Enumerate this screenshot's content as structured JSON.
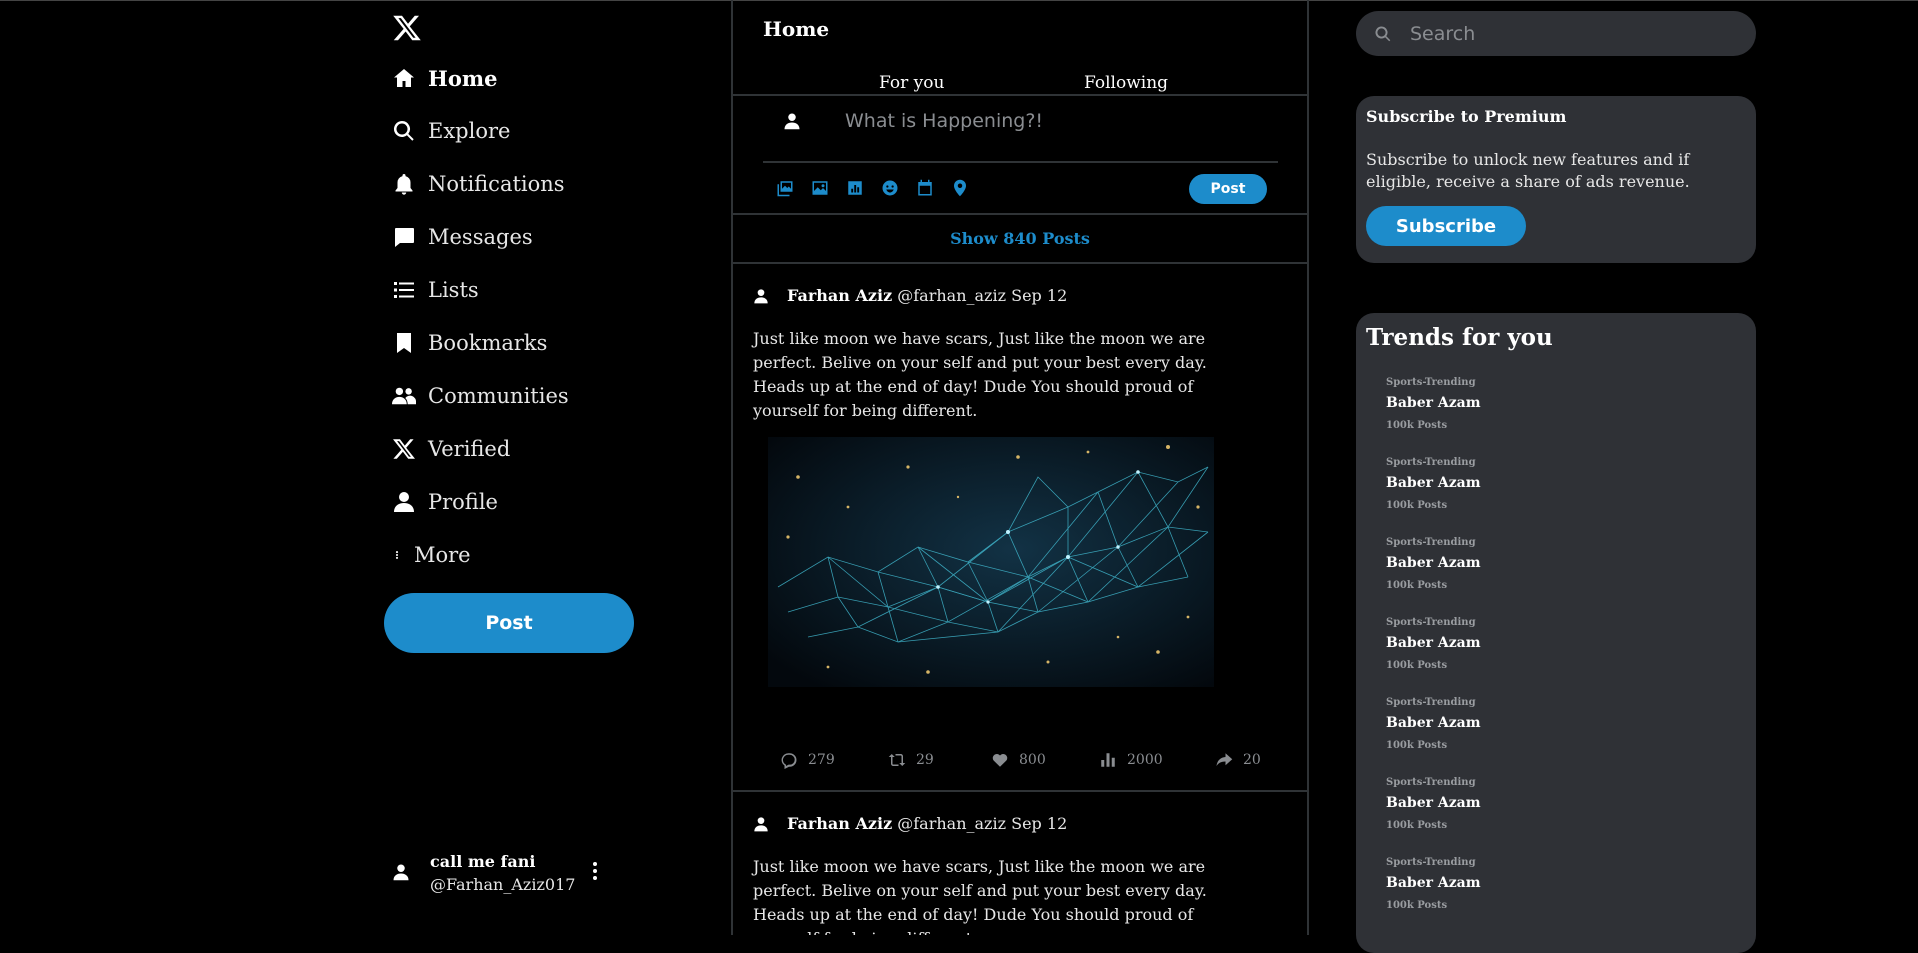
{
  "nav": {
    "items": [
      {
        "label": "Home",
        "icon": "home-icon"
      },
      {
        "label": "Explore",
        "icon": "search-icon"
      },
      {
        "label": "Notifications",
        "icon": "bell-icon"
      },
      {
        "label": "Messages",
        "icon": "message-icon"
      },
      {
        "label": "Lists",
        "icon": "list-icon"
      },
      {
        "label": "Bookmarks",
        "icon": "bookmark-icon"
      },
      {
        "label": "Communities",
        "icon": "communities-icon"
      },
      {
        "label": "Verified",
        "icon": "x-icon"
      },
      {
        "label": "Profile",
        "icon": "profile-icon"
      },
      {
        "label": "More",
        "icon": "more-vertical-icon"
      }
    ],
    "post_label": "Post"
  },
  "user": {
    "name": "call me fani",
    "handle": "@Farhan_Aziz017"
  },
  "feed": {
    "title": "Home",
    "tabs": [
      {
        "label": "For you"
      },
      {
        "label": "Following"
      }
    ],
    "compose": {
      "placeholder": "What is Happening?!",
      "post_label": "Post",
      "tools": [
        "gallery-icon",
        "image-icon",
        "chart-icon",
        "emoji-icon",
        "calendar-icon",
        "location-icon"
      ]
    },
    "show_posts": "Show 840 Posts",
    "tweets": [
      {
        "name": "Farhan Aziz",
        "handle": "@farhan_aziz",
        "date": "Sep 12",
        "text": "Just like moon we have scars, Just like the moon we are perfect. Belive on your self and put your best every day. Heads up at the end of day! Dude You should proud of yourself for being different.",
        "stats": {
          "replies": "279",
          "reposts": "29",
          "likes": "800",
          "views": "2000",
          "shares": "20"
        }
      },
      {
        "name": "Farhan Aziz",
        "handle": "@farhan_aziz",
        "date": "Sep 12",
        "text": "Just like moon we have scars, Just like the moon we are perfect. Belive on your self and put your best every day. Heads up at the end of day! Dude You should proud of yourself for being different."
      }
    ]
  },
  "search": {
    "placeholder": "Search"
  },
  "premium": {
    "title": "Subscribe to Premium",
    "description": "Subscribe to unlock new features and if eligible, receive a share of ads revenue.",
    "button": "Subscribe"
  },
  "trends": {
    "title": "Trends for you",
    "items": [
      {
        "category": "Sports-Trending",
        "name": "Baber Azam",
        "count": "100k Posts"
      },
      {
        "category": "Sports-Trending",
        "name": "Baber Azam",
        "count": "100k Posts"
      },
      {
        "category": "Sports-Trending",
        "name": "Baber Azam",
        "count": "100k Posts"
      },
      {
        "category": "Sports-Trending",
        "name": "Baber Azam",
        "count": "100k Posts"
      },
      {
        "category": "Sports-Trending",
        "name": "Baber Azam",
        "count": "100k Posts"
      },
      {
        "category": "Sports-Trending",
        "name": "Baber Azam",
        "count": "100k Posts"
      },
      {
        "category": "Sports-Trending",
        "name": "Baber Azam",
        "count": "100k Posts"
      }
    ]
  },
  "colors": {
    "accent": "#1d8ccb",
    "background": "#000000",
    "card": "#2f3136",
    "muted": "#8a8d91"
  }
}
